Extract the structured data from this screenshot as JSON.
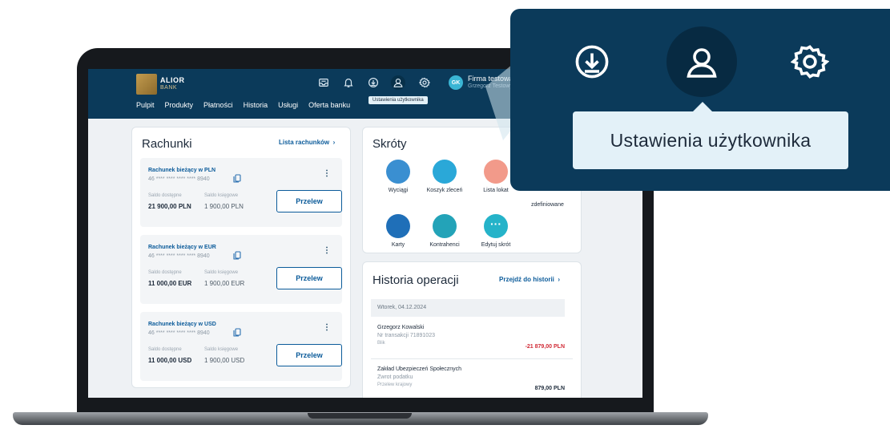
{
  "brand": {
    "line1": "ALIOR",
    "line2": "BANK"
  },
  "header": {
    "firm_name": "Firma testowa",
    "firm_user": "Grzegorz Testowy",
    "avatar_initials": "GK",
    "tooltip": "Ustawienia użytkownika",
    "icons": [
      "inbox-icon",
      "bell-icon",
      "download-icon",
      "user-icon",
      "settings-icon"
    ]
  },
  "nav": [
    "Pulpit",
    "Produkty",
    "Płatności",
    "Historia",
    "Usługi",
    "Oferta banku"
  ],
  "accounts_card": {
    "title": "Rachunki",
    "link": "Lista rachunków",
    "accounts": [
      {
        "name": "Rachunek bieżący w PLN",
        "number": "46 **** **** **** **** 8940",
        "label_available": "Saldo dostępne",
        "label_book": "Saldo księgowe",
        "available": "21 900,00 PLN",
        "book": "1 900,00 PLN",
        "button": "Przelew"
      },
      {
        "name": "Rachunek bieżący w EUR",
        "number": "46 **** **** **** **** 8940",
        "label_available": "Saldo dostępne",
        "label_book": "Saldo księgowe",
        "available": "11 000,00 EUR",
        "book": "1 900,00 EUR",
        "button": "Przelew"
      },
      {
        "name": "Rachunek bieżący w USD",
        "number": "46 **** **** **** **** 8940",
        "label_available": "Saldo dostępne",
        "label_book": "Saldo księgowe",
        "available": "11 000,00 USD",
        "book": "1 900,00 USD",
        "button": "Przelew"
      }
    ]
  },
  "shortcuts_card": {
    "title": "Skróty",
    "items": [
      {
        "label": "Wyciągi",
        "icon": "statements-icon",
        "color": "#3a8fd1"
      },
      {
        "label": "Koszyk zleceń",
        "icon": "basket-icon",
        "color": "#2aa8d8"
      },
      {
        "label": "Lista lokat",
        "icon": "piggy-bank-icon",
        "color": "#f29a8a"
      },
      {
        "label": "Karty",
        "icon": "card-icon",
        "color": "#1f6fb8"
      },
      {
        "label": "Kontrahenci",
        "icon": "contacts-icon",
        "color": "#23a3b8"
      },
      {
        "label": "Edytuj skrót",
        "icon": "more-icon",
        "color": "#25b3c9"
      }
    ],
    "extra_label": "zdefiniowane"
  },
  "history_card": {
    "title": "Historia operacji",
    "link": "Przejdź do historii",
    "date": "Wtorek, 04.12.2024",
    "transactions": [
      {
        "name": "Grzegorz Kowalski",
        "sub": "Nr transakcji 71891023",
        "type": "Blik",
        "amount": "-21 879,00 PLN",
        "color": "#d12b36"
      },
      {
        "name": "Zakład Ubezpieczeń Społecznych",
        "sub": "Zwrot podatku",
        "type": "Przelew krajowy",
        "amount": "879,00 PLN",
        "color": "#1d2a3a"
      }
    ]
  },
  "zoom": {
    "tooltip": "Ustawienia użytkownika",
    "icons": [
      "download-icon",
      "user-icon",
      "settings-icon"
    ]
  }
}
